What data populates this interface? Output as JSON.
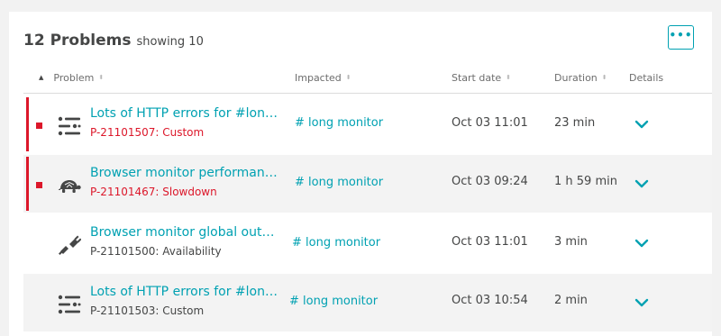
{
  "header": {
    "title": "12 Problems",
    "subtitle": "showing 10",
    "more_label": "•••",
    "more_icon": "more-dots-icon"
  },
  "columns": {
    "problem": "Problem",
    "impacted": "Impacted",
    "start_date": "Start date",
    "duration": "Duration",
    "details": "Details"
  },
  "sort_glyphs": {
    "active": "▲",
    "inactive": "⬍"
  },
  "colors": {
    "accent": "#00a1b2",
    "error": "#dc172a",
    "text": "#454646"
  },
  "rows": [
    {
      "icon": "sliders-icon",
      "title": "Lots of HTTP errors for #long monitor",
      "id": "P-21101507: Custom",
      "id_state": "open",
      "impacted": "# long monitor",
      "start": "Oct 03 11:01",
      "duration": "23 min"
    },
    {
      "icon": "turtle-icon",
      "title": "Browser monitor performance degradation",
      "id": "P-21101467: Slowdown",
      "id_state": "open",
      "impacted": "# long monitor",
      "start": "Oct 03 09:24",
      "duration": "1 h 59 min"
    },
    {
      "icon": "plug-icon",
      "title": "Browser monitor global outage",
      "id": "P-21101500: Availability",
      "id_state": "closed",
      "impacted": "# long monitor",
      "start": "Oct 03 11:01",
      "duration": "3 min"
    },
    {
      "icon": "sliders-icon",
      "title": "Lots of HTTP errors for #long monitor",
      "id": "P-21101503: Custom",
      "id_state": "closed",
      "impacted": "# long monitor",
      "start": "Oct 03 10:54",
      "duration": "2 min"
    }
  ]
}
